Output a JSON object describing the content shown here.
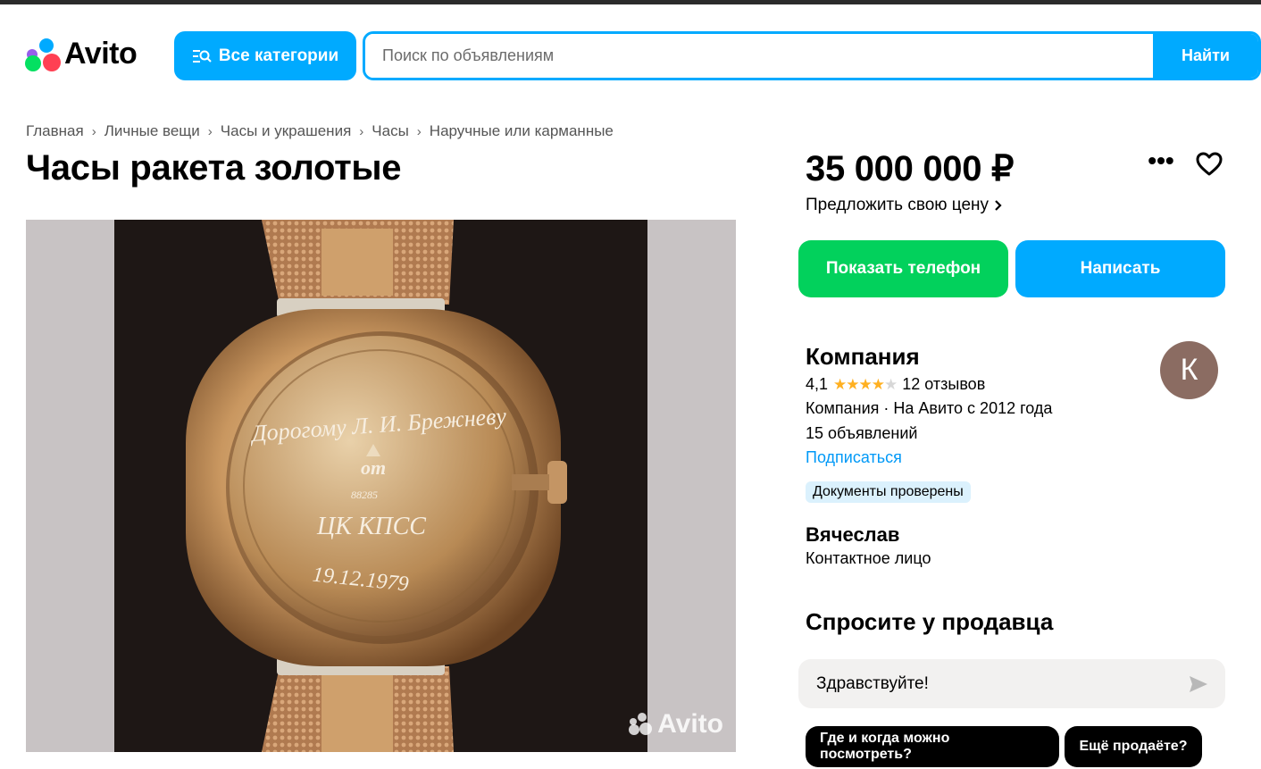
{
  "header": {
    "logo_text": "Avito",
    "categories_label": "Все категории",
    "search_placeholder": "Поиск по объявлениям",
    "search_button": "Найти"
  },
  "breadcrumbs": [
    "Главная",
    "Личные вещи",
    "Часы и украшения",
    "Часы",
    "Наручные или карманные"
  ],
  "listing": {
    "title": "Часы ракета золотые",
    "price": "35 000 000 ₽",
    "offer_price": "Предложить свою цену",
    "photo": {
      "watermark": "Avito",
      "engraving_line1": "Дорогому Л. И. Брежневу",
      "engraving_from": "от",
      "engraving_number": "88285",
      "engraving_org": "ЦК КПСС",
      "engraving_date": "19.12.1979"
    }
  },
  "actions": {
    "show_phone": "Показать телефон",
    "write": "Написать"
  },
  "seller": {
    "name": "Компания",
    "rating": "4,1",
    "rating_value": 4.1,
    "reviews": "12 отзывов",
    "meta": "Компания · На Авито с 2012 года",
    "ads_count": "15 объявлений",
    "subscribe": "Подписаться",
    "badge": "Документы проверены",
    "avatar_letter": "К",
    "avatar_color": "#8b6c62"
  },
  "contact": {
    "name": "Вячеслав",
    "role": "Контактное лицо"
  },
  "ask": {
    "title": "Спросите у продавца",
    "message": "Здравствуйте!",
    "chips": [
      "Где и когда можно посмотреть?",
      "Ещё продаёте?"
    ]
  },
  "colors": {
    "accent": "#00aaff",
    "phone_green": "#02d15c",
    "link": "#0099f7",
    "star": "#ffb021"
  }
}
